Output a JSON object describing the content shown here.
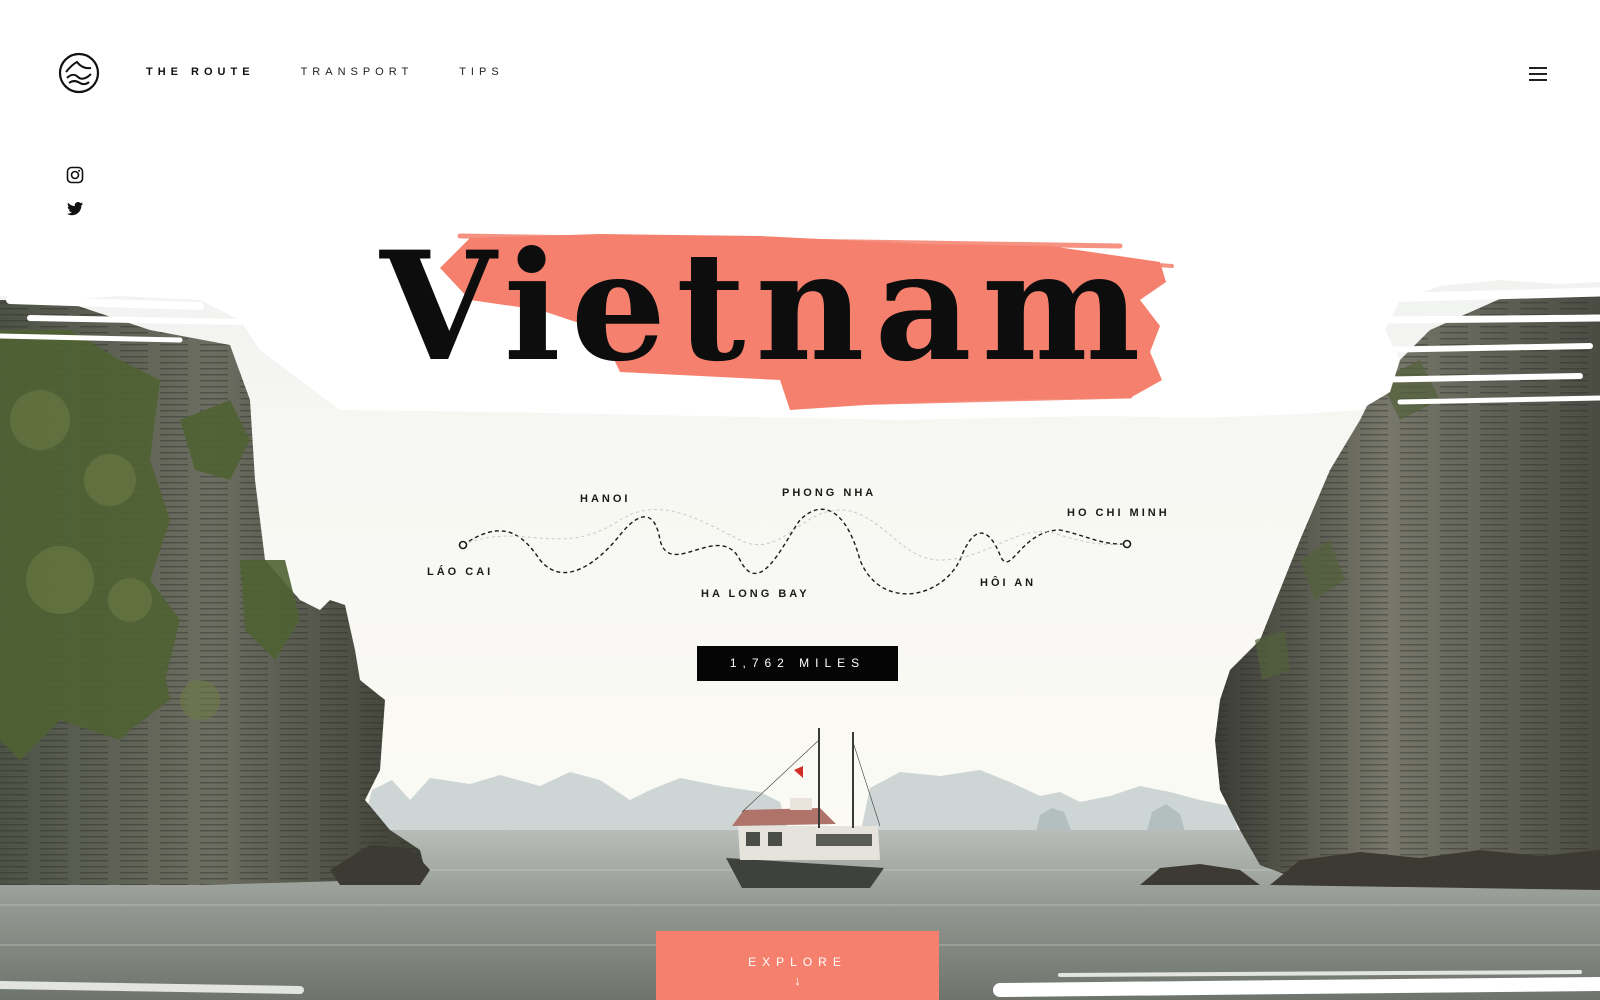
{
  "nav": {
    "items": [
      {
        "label": "THE ROUTE",
        "active": true
      },
      {
        "label": "TRANSPORT",
        "active": false
      },
      {
        "label": "TIPS",
        "active": false
      }
    ]
  },
  "icons": {
    "logo": "mountain-wave-logo-icon",
    "menu": "hamburger-menu-icon",
    "instagram": "instagram-icon",
    "twitter": "twitter-icon"
  },
  "hero": {
    "title": "Vietnam",
    "accent_color": "#f5806d"
  },
  "route": {
    "stops": [
      "LÁO CAI",
      "HANOI",
      "HA LONG BAY",
      "PHONG NHA",
      "HÔI AN",
      "HO CHI MINH"
    ],
    "distance": "1,762 MILES"
  },
  "cta": {
    "label": "EXPLORE",
    "arrow": "↓"
  }
}
